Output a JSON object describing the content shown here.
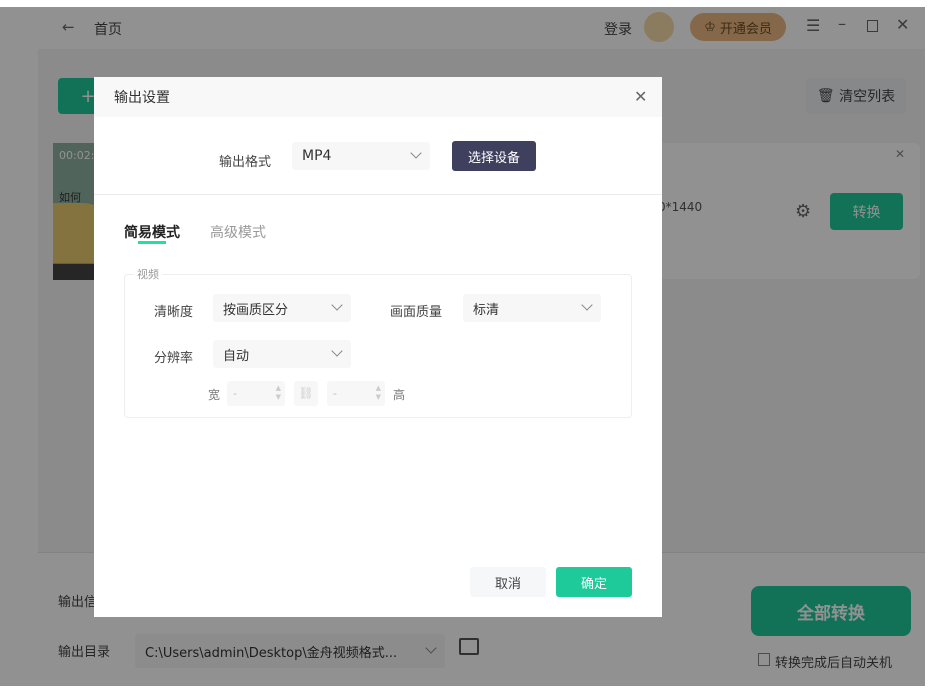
{
  "header": {
    "back_label": "首页",
    "login": "登录",
    "vip": "开通会员"
  },
  "toolbar": {
    "add_label": "+",
    "clear_list": "清空列表"
  },
  "file_item": {
    "duration": "00:02:",
    "title_fragment": "如何",
    "resolution": "0*1440",
    "convert": "转换"
  },
  "bottom": {
    "output_info_label": "输出信",
    "output_dir_label": "输出目录",
    "output_dir": "C:\\Users\\admin\\Desktop\\金舟视频格式...",
    "convert_all": "全部转换",
    "auto_shutdown": "转换完成后自动关机"
  },
  "dialog": {
    "title": "输出设置",
    "format_label": "输出格式",
    "format_value": "MP4",
    "select_device": "选择设备",
    "tabs": [
      {
        "label": "简易模式",
        "active": true
      },
      {
        "label": "高级模式",
        "active": false
      }
    ],
    "group_label": "视频",
    "clarity_label": "清晰度",
    "clarity_value": "按画质区分",
    "quality_label": "画面质量",
    "quality_value": "标清",
    "resolution_label": "分辨率",
    "resolution_value": "自动",
    "width_label": "宽",
    "width_value": "-",
    "height_label": "高",
    "height_value": "-",
    "cancel": "取消",
    "confirm": "确定"
  },
  "colors": {
    "accent": "#1ec99a",
    "device_button": "#3f3f5e",
    "vip": "#e8b880"
  }
}
